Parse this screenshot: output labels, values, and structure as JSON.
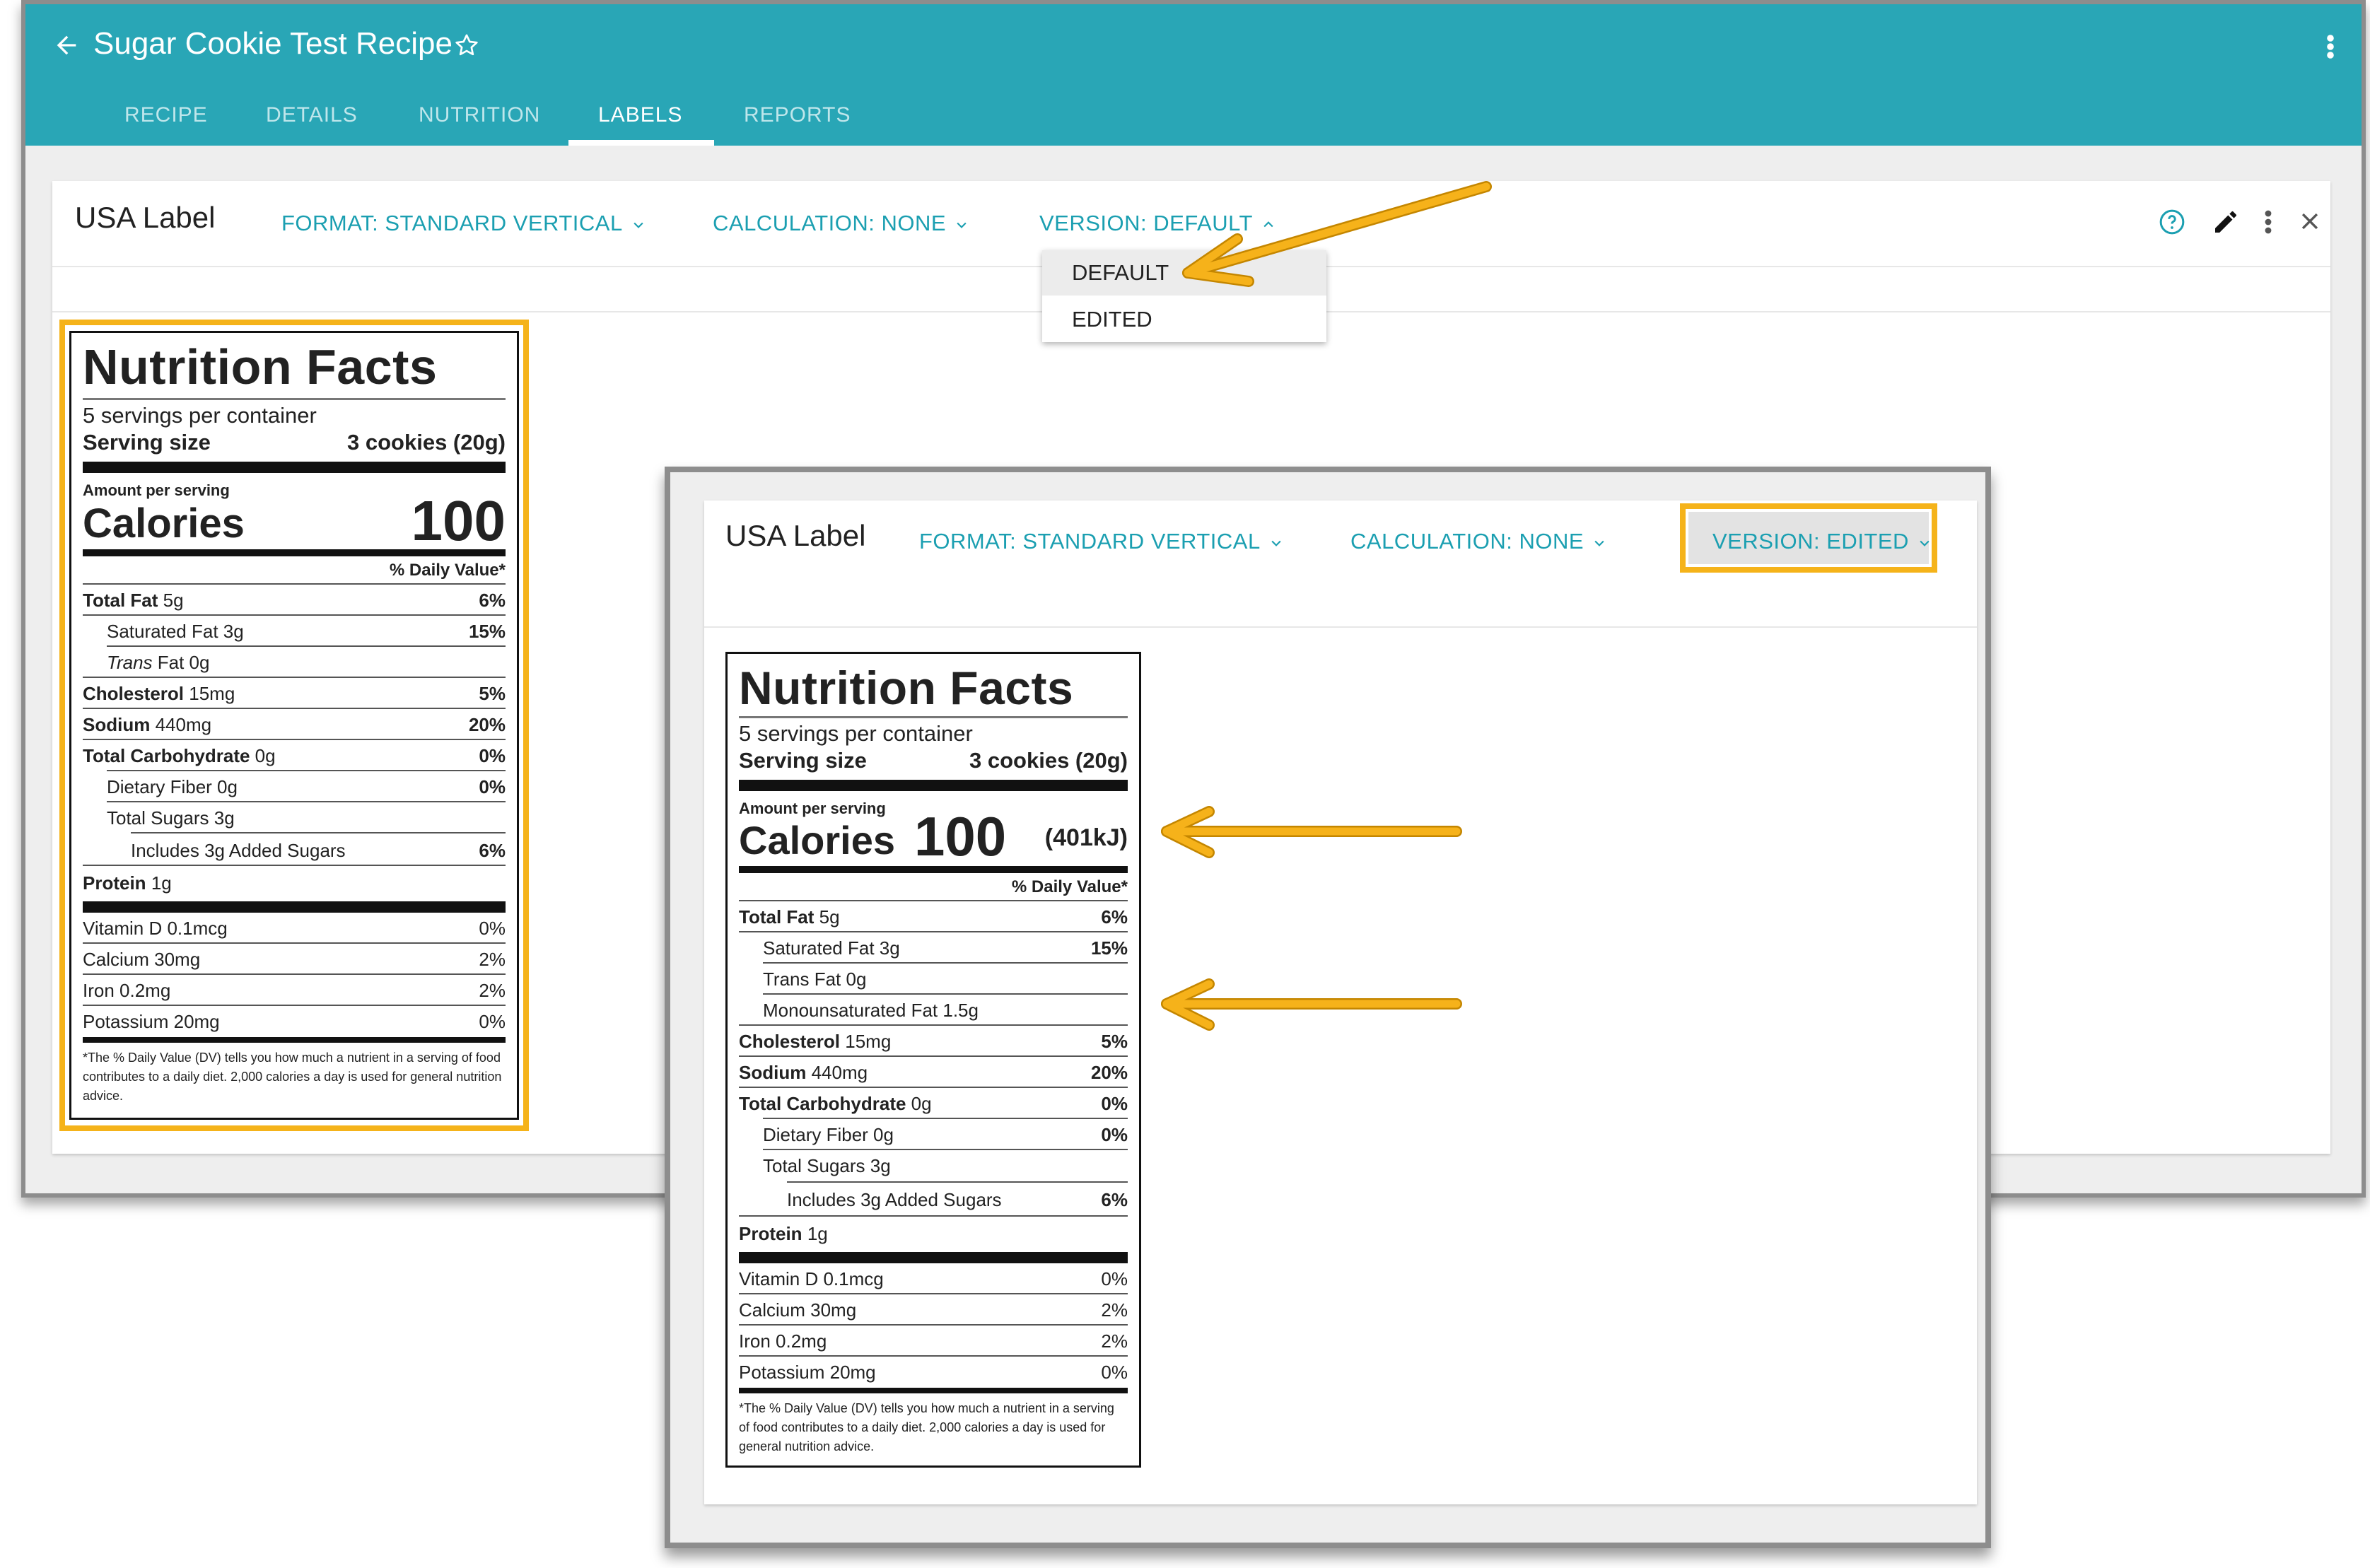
{
  "app": {
    "title": "Sugar Cookie Test Recipe",
    "tabs": [
      "RECIPE",
      "DETAILS",
      "NUTRITION",
      "LABELS",
      "REPORTS"
    ],
    "active_tab": "LABELS"
  },
  "card1": {
    "title": "USA Label",
    "format": "FORMAT: STANDARD VERTICAL",
    "calculation": "CALCULATION: NONE",
    "version": "VERSION: DEFAULT",
    "version_menu": [
      "DEFAULT",
      "EDITED"
    ]
  },
  "card2": {
    "title": "USA Label",
    "format": "FORMAT: STANDARD VERTICAL",
    "calculation": "CALCULATION: NONE",
    "version": "VERSION: EDITED"
  },
  "label1": {
    "title": "Nutrition Facts",
    "servings": "5 servings per container",
    "serving_size_label": "Serving size",
    "serving_size_value": "3 cookies (20g)",
    "amount_per_serving": "Amount per serving",
    "calories_label": "Calories",
    "calories_value": "100",
    "dv_header": "% Daily Value*",
    "total_fat": {
      "name": "Total Fat",
      "amount": "5g",
      "dv": "6%"
    },
    "sat_fat": {
      "name": "Saturated Fat 3g",
      "dv": "15%"
    },
    "trans_fat": {
      "name": "Trans",
      "amount": "Fat 0g"
    },
    "cholesterol": {
      "name": "Cholesterol",
      "amount": "15mg",
      "dv": "5%"
    },
    "sodium": {
      "name": "Sodium",
      "amount": "440mg",
      "dv": "20%"
    },
    "carb": {
      "name": "Total Carbohydrate",
      "amount": "0g",
      "dv": "0%"
    },
    "fiber": {
      "name": "Dietary Fiber 0g",
      "dv": "0%"
    },
    "sugars": {
      "name": "Total Sugars 3g"
    },
    "added": {
      "name": "Includes 3g Added Sugars",
      "dv": "6%"
    },
    "protein": {
      "name": "Protein",
      "amount": "1g"
    },
    "vitd": {
      "name": "Vitamin D 0.1mcg",
      "dv": "0%"
    },
    "calcium": {
      "name": "Calcium 30mg",
      "dv": "2%"
    },
    "iron": {
      "name": "Iron 0.2mg",
      "dv": "2%"
    },
    "potassium": {
      "name": "Potassium 20mg",
      "dv": "0%"
    },
    "footnote": "*The % Daily Value (DV) tells you how much a nutrient in a serving of food contributes to a daily diet. 2,000 calories a day is used for general nutrition advice."
  },
  "label2": {
    "title": "Nutrition Facts",
    "servings": "5 servings per container",
    "serving_size_label": "Serving size",
    "serving_size_value": "3 cookies (20g)",
    "amount_per_serving": "Amount per serving",
    "calories_label": "Calories",
    "calories_value": "100",
    "calories_kj": "(401kJ)",
    "dv_header": "% Daily Value*",
    "total_fat": {
      "name": "Total Fat",
      "amount": "5g",
      "dv": "6%"
    },
    "sat_fat": {
      "name": "Saturated Fat 3g",
      "dv": "15%"
    },
    "trans_fat": {
      "name": "Trans Fat 0g"
    },
    "mono_fat": {
      "name": "Monounsaturated Fat 1.5g"
    },
    "cholesterol": {
      "name": "Cholesterol",
      "amount": "15mg",
      "dv": "5%"
    },
    "sodium": {
      "name": "Sodium",
      "amount": "440mg",
      "dv": "20%"
    },
    "carb": {
      "name": "Total Carbohydrate",
      "amount": "0g",
      "dv": "0%"
    },
    "fiber": {
      "name": "Dietary Fiber 0g",
      "dv": "0%"
    },
    "sugars": {
      "name": "Total Sugars 3g"
    },
    "added": {
      "name": "Includes 3g Added Sugars",
      "dv": "6%"
    },
    "protein": {
      "name": "Protein",
      "amount": "1g"
    },
    "vitd": {
      "name": "Vitamin D 0.1mcg",
      "dv": "0%"
    },
    "calcium": {
      "name": "Calcium 30mg",
      "dv": "2%"
    },
    "iron": {
      "name": "Iron 0.2mg",
      "dv": "2%"
    },
    "potassium": {
      "name": "Potassium 20mg",
      "dv": "0%"
    },
    "footnote": "*The % Daily Value (DV) tells you how much a nutrient in a serving of food contributes to a daily diet. 2,000 calories a day is used for general nutrition advice."
  },
  "icons": [
    "back-arrow-icon",
    "star-outline-icon",
    "more-vert-icon",
    "help-circle-icon",
    "pencil-icon",
    "close-icon",
    "chevron-down-icon",
    "chevron-up-icon"
  ],
  "colors": {
    "header": "#29a6b6",
    "accent_text": "#1b9fb1",
    "highlight": "#f5b31a",
    "window_border": "#8d8d8d"
  }
}
